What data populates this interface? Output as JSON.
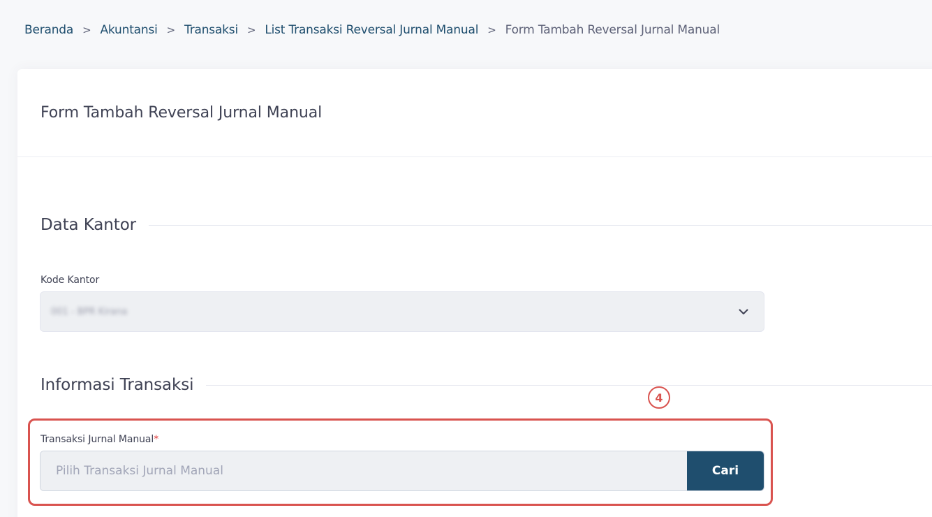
{
  "breadcrumb": {
    "items": [
      "Beranda",
      "Akuntansi",
      "Transaksi",
      "List Transaksi Reversal Jurnal Manual"
    ],
    "current": "Form Tambah Reversal Jurnal Manual",
    "separator": ">"
  },
  "card": {
    "title": "Form Tambah Reversal Jurnal Manual"
  },
  "data_kantor": {
    "section_title": "Data Kantor",
    "kode_kantor_label": "Kode Kantor",
    "kode_kantor_value": "001 - BPR Kirana"
  },
  "informasi_transaksi": {
    "section_title": "Informasi Transaksi",
    "step_number": "4",
    "field_label": "Transaksi Jurnal Manual",
    "required_marker": "*",
    "placeholder": "Pilih Transaksi Jurnal Manual",
    "value": "",
    "button_label": "Cari"
  },
  "colors": {
    "primary": "#1f4e6e",
    "highlight": "#d9534f",
    "required": "#e03a3a"
  }
}
